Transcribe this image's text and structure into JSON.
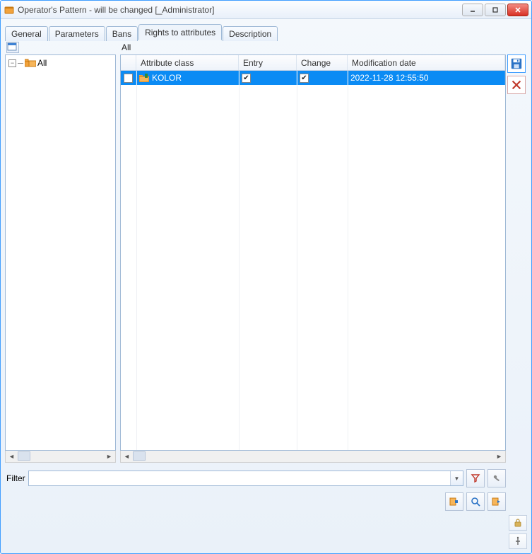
{
  "window": {
    "title": "Operator's Pattern - will be changed [_Administrator]"
  },
  "tabs": [
    {
      "label": "General",
      "active": false
    },
    {
      "label": "Parameters",
      "active": false
    },
    {
      "label": "Bans",
      "active": false
    },
    {
      "label": "Rights to attributes",
      "active": true
    },
    {
      "label": "Description",
      "active": false
    }
  ],
  "tree": {
    "root_label": "All"
  },
  "grid": {
    "heading": "All",
    "columns": {
      "attribute_class": "Attribute class",
      "entry": "Entry",
      "change": "Change",
      "modification_date": "Modification date"
    },
    "rows": [
      {
        "name": "KOLOR",
        "entry": true,
        "change": true,
        "modified": "2022-11-28 12:55:50",
        "selected": true,
        "checked": false
      }
    ]
  },
  "filter": {
    "label": "Filter",
    "value": "",
    "placeholder": ""
  },
  "icons": {
    "save": "save-icon",
    "delete": "delete-icon",
    "filter_build": "filter-build-icon",
    "filter_wrench": "filter-wrench-icon",
    "btn_a": "action-a-icon",
    "btn_search": "search-icon",
    "btn_c": "action-c-icon",
    "lock": "lock-icon",
    "pin": "pin-icon"
  }
}
